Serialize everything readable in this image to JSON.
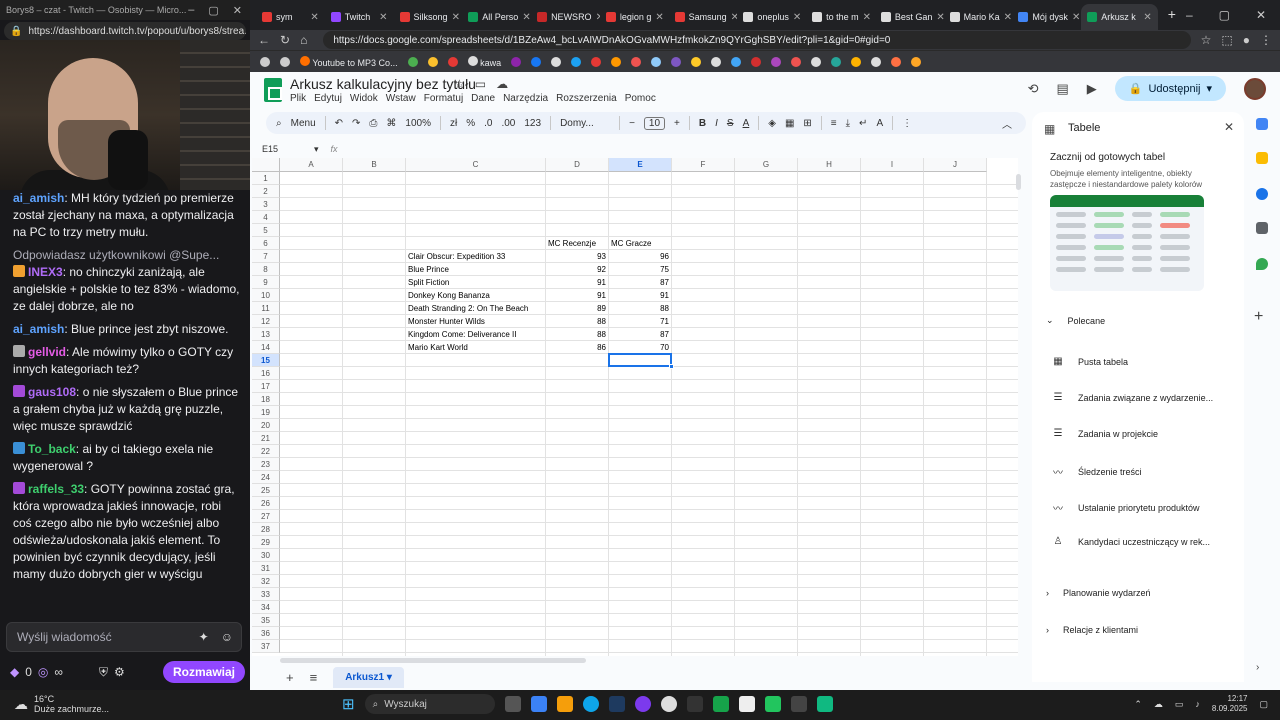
{
  "twitch": {
    "window_title": "Borys8 – czat - Twitch — Osobisty — Micro...",
    "url": "https://dashboard.twitch.tv/popout/u/borys8/strea...",
    "messages": [
      {
        "user": "ai_amish",
        "color": "#5ea3ff",
        "text": ": MH który tydzień po premierze został zjechany na maxa, a optymalizacja na PC to trzy metry mułu."
      },
      {
        "reply": "Odpowiadasz użytkownikowi @Supe...",
        "user": "INEX3",
        "color": "#b06cf7",
        "badge": "#f0a030",
        "text": ": no chinczyki zaniżają, ale angielskie + polskie to tez 83% - wiadomo, ze dalej dobrze, ale no"
      },
      {
        "user": "ai_amish",
        "color": "#5ea3ff",
        "text": ": Blue prince jest zbyt niszowe."
      },
      {
        "user": "gellvid",
        "color": "#e55ce6",
        "badge": "#aaaaaa",
        "text": ": Ale mówimy tylko o GOTY czy innych kategoriach też?"
      },
      {
        "user": "gaus108",
        "color": "#b06cf7",
        "badge": "#a34ad8",
        "text": ": o nie słyszałem o Blue prince a grałem chyba już w każdą grę puzzle, więc musze sprawdzić"
      },
      {
        "user": "To_back",
        "color": "#3ecf6e",
        "badge": "#3a8fd6",
        "text": ": ai by ci takiego exela nie wygenerowal ?"
      },
      {
        "user": "raffels_33",
        "color": "#3ecf6e",
        "badge": "#a34ad8",
        "text": ": GOTY powinna zostać gra, która wprowadza jakieś innowacje, robi coś czego albo nie było wcześniej albo odświeża/udoskonala jakiś element. To powinien być czynnik decydujący, jeśli mamy dużo dobrych gier w wyścigu"
      }
    ],
    "input_placeholder": "Wyślij wiadomość",
    "points": "0",
    "infinity": "∞",
    "chat_button": "Rozmawiaj"
  },
  "tabs": [
    {
      "label": "sym",
      "color": "#e53935"
    },
    {
      "label": "Twitch",
      "color": "#9147ff"
    },
    {
      "label": "Silksong",
      "color": "#e53935"
    },
    {
      "label": "All Perso",
      "color": "#0f9d58"
    },
    {
      "label": "NEWSRO",
      "color": "#c62828"
    },
    {
      "label": "legion g",
      "color": "#e53935"
    },
    {
      "label": "Samsung",
      "color": "#e53935"
    },
    {
      "label": "oneplus",
      "color": "#dddddd"
    },
    {
      "label": "to the m",
      "color": "#dddddd"
    },
    {
      "label": "Best Gan",
      "color": "#dddddd"
    },
    {
      "label": "Mario Ka",
      "color": "#dddddd"
    },
    {
      "label": "Mój dysk",
      "color": "#4285f4"
    },
    {
      "label": "Arkusz k",
      "color": "#0f9d58",
      "active": true
    }
  ],
  "address": "https://docs.google.com/spreadsheets/d/1BZeAw4_bcLvAIWDnAkOGvaMWHzfmkokZn9QYrGghSBY/edit?pli=1&gid=0#gid=0",
  "bookmarks": {
    "yt": "Youtube to MP3 Co...",
    "kawa": "kawa"
  },
  "sheet": {
    "title": "Arkusz kalkulacyjny bez tytułu",
    "menu": [
      "Plik",
      "Edytuj",
      "Widok",
      "Wstaw",
      "Formatuj",
      "Dane",
      "Narzędzia",
      "Rozszerzenia",
      "Pomoc"
    ],
    "share": "Udostępnij",
    "toolbar": {
      "menu": "Menu",
      "zoom": "100%",
      "currency": "zł",
      "percent": "%",
      "decimals_less": ".0",
      "decimals_more": ".00",
      "format": "123",
      "font": "Domy...",
      "font_size": "10"
    },
    "name_box": "E15",
    "fx": "fx",
    "columns": [
      "A",
      "B",
      "C",
      "D",
      "E",
      "F",
      "G",
      "H",
      "I",
      "J"
    ],
    "selected_col": "E",
    "selected_row": "15",
    "header_row": {
      "row": 6,
      "d": "MC Recenzje",
      "e": "MC Gracze"
    },
    "rows": [
      {
        "row": 7,
        "game": "Clair Obscur: Expedition 33",
        "critics": "93",
        "users": "96"
      },
      {
        "row": 8,
        "game": "Blue Prince",
        "critics": "92",
        "users": "75"
      },
      {
        "row": 9,
        "game": "Split Fiction",
        "critics": "91",
        "users": "87"
      },
      {
        "row": 10,
        "game": "Donkey Kong Bananza",
        "critics": "91",
        "users": "91"
      },
      {
        "row": 11,
        "game": "Death Stranding 2: On The Beach",
        "critics": "89",
        "users": "88"
      },
      {
        "row": 12,
        "game": "Monster Hunter Wilds",
        "critics": "88",
        "users": "71"
      },
      {
        "row": 13,
        "game": "Kingdom Come: Deliverance II",
        "critics": "88",
        "users": "87"
      },
      {
        "row": 14,
        "game": "Mario Kart World",
        "critics": "86",
        "users": "70"
      }
    ],
    "sheet_tab": "Arkusz1"
  },
  "panel": {
    "title": "Tabele",
    "heading": "Zacznij od gotowych tabel",
    "desc": "Obejmuje elementy inteligentne, obiekty zastępcze i niestandardowe palety kolorów",
    "recommended": "Polecane",
    "items": [
      "Pusta tabela",
      "Zadania związane z wydarzenie...",
      "Zadania w projekcie",
      "Śledzenie treści",
      "Ustalanie priorytetu produktów",
      "Kandydaci uczestniczący w rek..."
    ],
    "sections": [
      "Planowanie wydarzeń",
      "Relacje z klientami"
    ]
  },
  "taskbar": {
    "temp": "16°C",
    "weather": "Duże zachmurze...",
    "search": "Wyszukaj",
    "time": "12:17",
    "date": "8.09.2025"
  }
}
